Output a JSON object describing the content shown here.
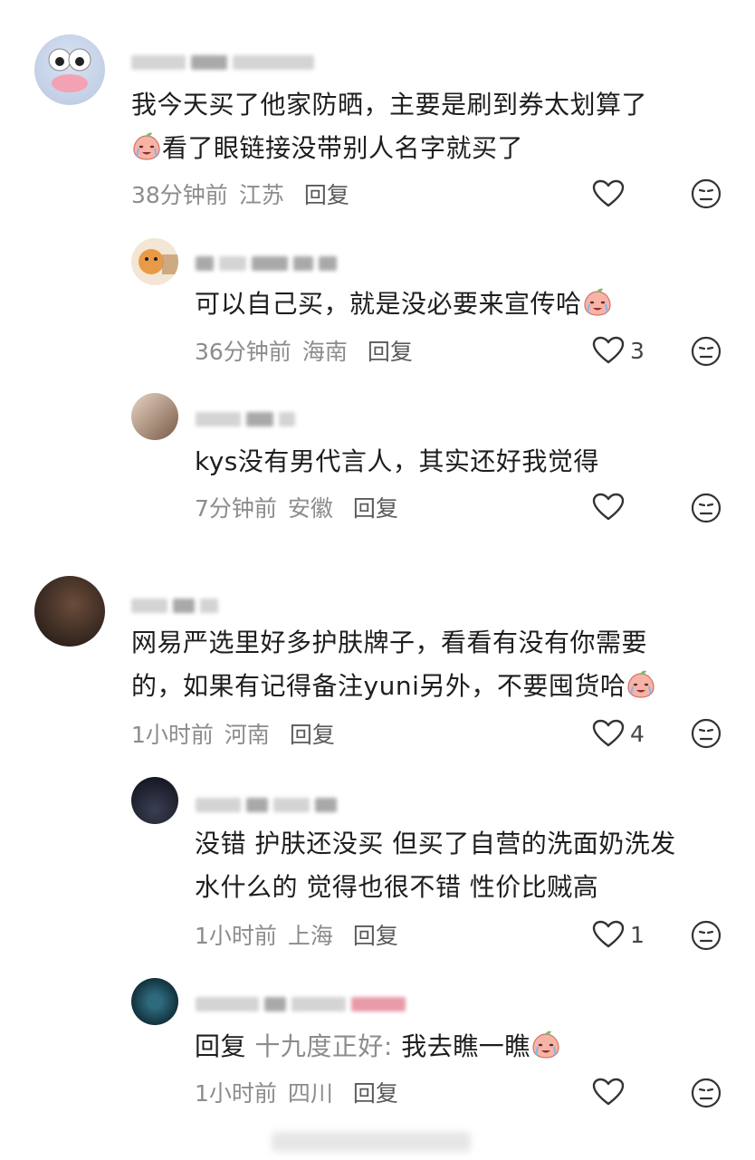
{
  "comments": [
    {
      "text_lines": [
        "我今天买了他家防晒，主要是刷到券太划算了",
        "看了眼链接没带别人名字就买了"
      ],
      "time": "38分钟前",
      "location": "江苏",
      "reply_label": "回复",
      "likes": "",
      "replies": [
        {
          "text_lines": [
            "可以自己买，就是没必要来宣传哈"
          ],
          "time": "36分钟前",
          "location": "海南",
          "reply_label": "回复",
          "likes": "3"
        },
        {
          "text_lines": [
            "kys没有男代言人，其实还好我觉得"
          ],
          "time": "7分钟前",
          "location": "安徽",
          "reply_label": "回复",
          "likes": ""
        }
      ]
    },
    {
      "text_lines": [
        "网易严选里好多护肤牌子，看看有没有你需要",
        "的，如果有记得备注yuni另外，不要囤货哈"
      ],
      "time": "1小时前",
      "location": "河南",
      "reply_label": "回复",
      "likes": "4",
      "replies": [
        {
          "text_lines": [
            "没错 护肤还没买 但买了自营的洗面奶洗发",
            "水什么的 觉得也很不错 性价比贼高"
          ],
          "time": "1小时前",
          "location": "上海",
          "reply_label": "回复",
          "likes": "1"
        },
        {
          "reply_prefix": "回复",
          "reply_to": "十九度正好:",
          "text_lines": [
            "我去瞧一瞧"
          ],
          "time": "1小时前",
          "location": "四川",
          "reply_label": "回复",
          "likes": ""
        }
      ]
    }
  ],
  "icons": {
    "like": "heart-outline-icon",
    "dislike": "meh-face-icon",
    "emoji_crying": "crying-peach-emoji",
    "emoji_laugh_cry": "laugh-cry-peach-emoji",
    "emoji_shock": "shocked-peach-emoji"
  },
  "colors": {
    "text": "#1e1e1e",
    "meta": "#8c8c8c",
    "emoji": "#f4a9a0"
  }
}
